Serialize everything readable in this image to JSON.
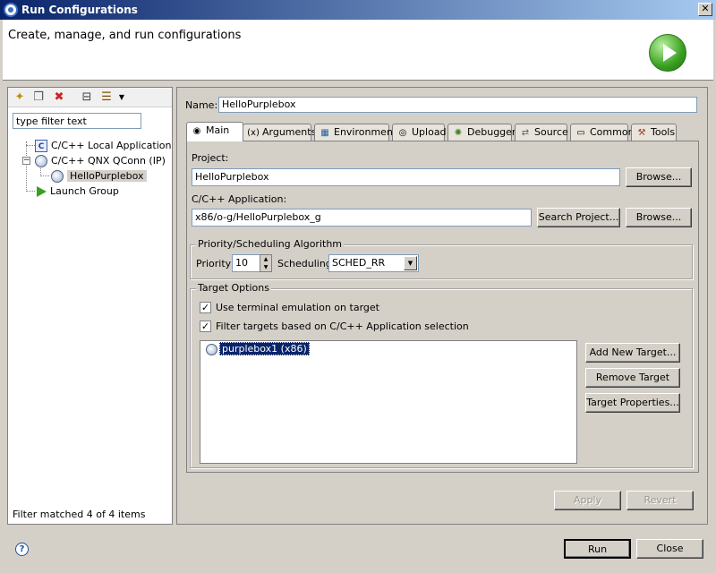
{
  "window": {
    "title": "Run Configurations",
    "close_glyph": "✕"
  },
  "header": {
    "title": "Create, manage, and run configurations"
  },
  "left": {
    "filter_placeholder": "type filter text",
    "filter_value": "type filter text",
    "tree": [
      {
        "label": "C/C++ Local Application",
        "icon": "c-app-icon"
      },
      {
        "label": "C/C++ QNX QConn (IP)",
        "icon": "qnx-icon"
      },
      {
        "label": "HelloPurplebox",
        "icon": "qnx-config-icon"
      },
      {
        "label": "Launch Group",
        "icon": "launch-icon"
      }
    ],
    "expander_glyph": "−",
    "status": "Filter matched 4 of 4 items"
  },
  "right": {
    "name_label": "Name:",
    "name_value": "HelloPurplebox",
    "tabs": [
      {
        "label": "Main",
        "icon": "main-tab-icon"
      },
      {
        "label": "Arguments",
        "icon": "arguments-tab-icon"
      },
      {
        "label": "Environment",
        "icon": "environment-tab-icon"
      },
      {
        "label": "Upload",
        "icon": "upload-tab-icon"
      },
      {
        "label": "Debugger",
        "icon": "debugger-tab-icon"
      },
      {
        "label": "Source",
        "icon": "source-tab-icon"
      },
      {
        "label": "Common",
        "icon": "common-tab-icon"
      },
      {
        "label": "Tools",
        "icon": "tools-tab-icon"
      }
    ],
    "project_label": "Project:",
    "project_value": "HelloPurplebox",
    "browse_label": "Browse...",
    "app_label": "C/C++ Application:",
    "app_value": "x86/o-g/HelloPurplebox_g",
    "search_project_label": "Search Project...",
    "priority_group": {
      "title": "Priority/Scheduling Algorithm",
      "priority_label": "Priority",
      "priority_value": "10",
      "scheduling_label": "Scheduling",
      "scheduling_value": "SCHED_RR"
    },
    "target_group": {
      "title": "Target Options",
      "check_terminal": "Use terminal emulation on target",
      "check_filter": "Filter targets based on C/C++ Application selection",
      "check_glyph": "✓",
      "target_item": "purplebox1 (x86)",
      "add_target": "Add New Target...",
      "remove_target": "Remove Target",
      "target_properties": "Target Properties..."
    },
    "apply_label": "Apply",
    "revert_label": "Revert"
  },
  "footer": {
    "help_glyph": "?",
    "run_label": "Run",
    "close_label": "Close"
  },
  "colors": {
    "title_bar": "#0a246a",
    "dialog_bg": "#d4d0c8",
    "selection": "#0a246a",
    "run_green": "#3aa020"
  }
}
